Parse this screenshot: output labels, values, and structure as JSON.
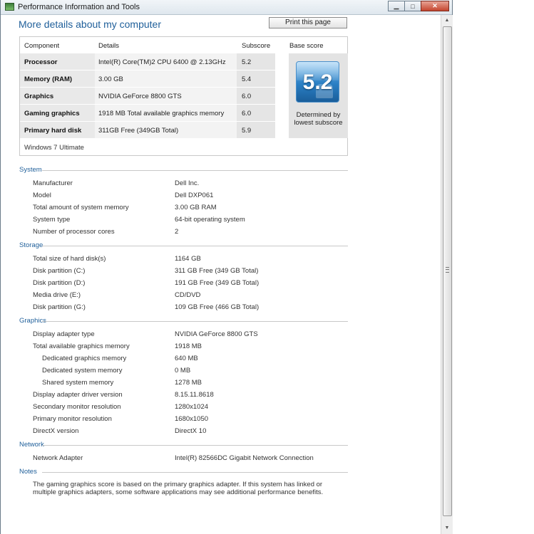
{
  "window": {
    "title": "Performance Information and Tools"
  },
  "header": {
    "title": "More details about my computer",
    "print_label": "Print this page"
  },
  "score_table": {
    "headers": {
      "component": "Component",
      "details": "Details",
      "subscore": "Subscore",
      "base": "Base score"
    },
    "rows": [
      {
        "component": "Processor",
        "details": "Intel(R) Core(TM)2 CPU 6400 @ 2.13GHz",
        "subscore": "5.2"
      },
      {
        "component": "Memory (RAM)",
        "details": "3.00 GB",
        "subscore": "5.4"
      },
      {
        "component": "Graphics",
        "details": "NVIDIA GeForce 8800 GTS",
        "subscore": "6.0"
      },
      {
        "component": "Gaming graphics",
        "details": "1918 MB Total available graphics memory",
        "subscore": "6.0"
      },
      {
        "component": "Primary hard disk",
        "details": "311GB Free (349GB Total)",
        "subscore": "5.9"
      }
    ],
    "base_score": "5.2",
    "base_caption": "Determined by lowest subscore",
    "os": "Windows 7 Ultimate"
  },
  "system": {
    "title": "System",
    "rows": [
      {
        "label": "Manufacturer",
        "value": "Dell Inc."
      },
      {
        "label": "Model",
        "value": "Dell DXP061"
      },
      {
        "label": "Total amount of system memory",
        "value": "3.00 GB RAM"
      },
      {
        "label": "System type",
        "value": "64-bit operating system"
      },
      {
        "label": "Number of processor cores",
        "value": "2"
      }
    ]
  },
  "storage": {
    "title": "Storage",
    "rows": [
      {
        "label": "Total size of hard disk(s)",
        "value": "1164 GB"
      },
      {
        "label": "Disk partition (C:)",
        "value": "311 GB Free (349 GB Total)"
      },
      {
        "label": "Disk partition (D:)",
        "value": "191 GB Free (349 GB Total)"
      },
      {
        "label": "Media drive (E:)",
        "value": "CD/DVD"
      },
      {
        "label": "Disk partition (G:)",
        "value": "109 GB Free (466 GB Total)"
      }
    ]
  },
  "graphics": {
    "title": "Graphics",
    "rows": [
      {
        "label": "Display adapter type",
        "value": "NVIDIA GeForce 8800 GTS"
      },
      {
        "label": "Total available graphics memory",
        "value": "1918 MB"
      },
      {
        "label": "Dedicated graphics memory",
        "value": "640 MB"
      },
      {
        "label": "Dedicated system memory",
        "value": "0 MB"
      },
      {
        "label": "Shared system memory",
        "value": "1278 MB"
      },
      {
        "label": "Display adapter driver version",
        "value": "8.15.11.8618"
      },
      {
        "label": "Secondary monitor resolution",
        "value": "1280x1024"
      },
      {
        "label": "Primary monitor resolution",
        "value": "1680x1050"
      },
      {
        "label": "DirectX version",
        "value": "DirectX 10"
      }
    ]
  },
  "network": {
    "title": "Network",
    "rows": [
      {
        "label": "Network Adapter",
        "value": "Intel(R) 82566DC Gigabit Network Connection"
      }
    ]
  },
  "notes": {
    "title": "Notes",
    "text": "The gaming graphics score is based on the primary graphics adapter. If this system has linked or multiple graphics adapters, some software applications may see additional performance benefits."
  }
}
